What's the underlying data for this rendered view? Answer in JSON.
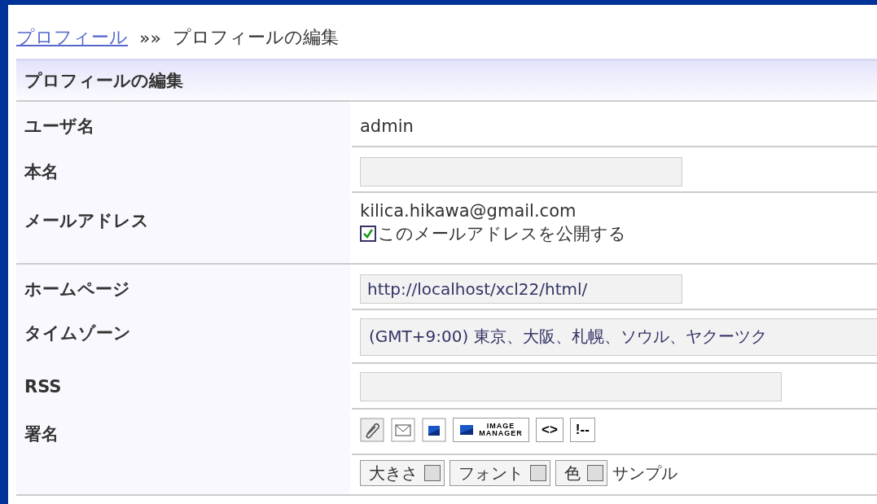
{
  "breadcrumb": {
    "link": "プロフィール",
    "separator": "»»",
    "current": "プロフィールの編集"
  },
  "form": {
    "title": "プロフィールの編集",
    "rows": [
      {
        "kind": "text",
        "label": "ユーザ名",
        "value": "admin"
      },
      {
        "kind": "input",
        "label": "本名"
      },
      {
        "kind": "email",
        "label": "メールアドレス",
        "value": "kilica.hikawa@gmail.com",
        "checkbox": {
          "label": "このメールアドレスを公開する",
          "checked": true
        }
      },
      {
        "kind": "input",
        "label": "ホームページ",
        "value": "http://localhost/xcl22/html/"
      },
      {
        "kind": "select",
        "label": "タイムゾーン",
        "value": "(GMT+9:00) 東京、大阪、札幌、ソウル、ヤクーツク"
      },
      {
        "kind": "longinput",
        "label": "RSS"
      },
      {
        "kind": "toolbar",
        "label": "署名",
        "buttons": [
          {
            "kind": "attach"
          },
          {
            "kind": "mail"
          },
          {
            "kind": "image"
          },
          {
            "kind": "manager",
            "text": "IMAGE MANAGER"
          },
          {
            "kind": "code",
            "text": "<>"
          },
          {
            "kind": "comment",
            "text": "!--"
          }
        ]
      },
      {
        "kind": "selects",
        "selects": [
          "大きさ",
          "フォント",
          "色"
        ],
        "sample": "サンプル"
      }
    ]
  }
}
